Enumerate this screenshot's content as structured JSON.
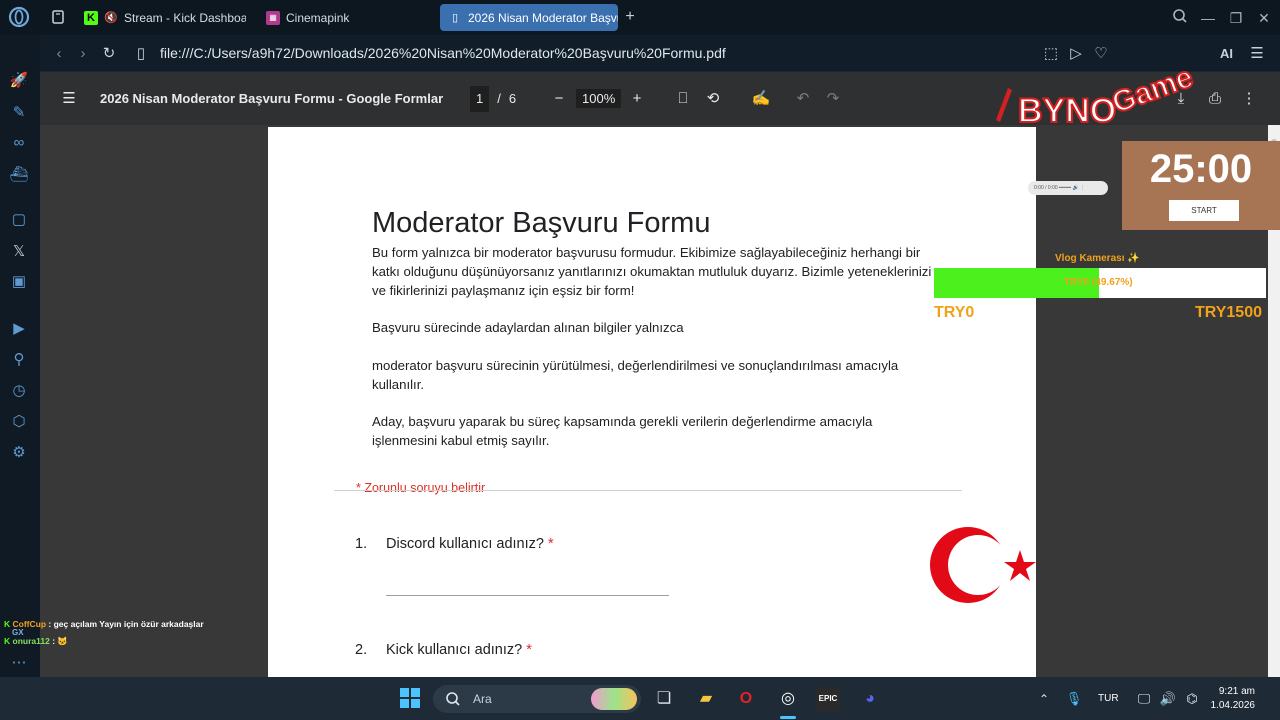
{
  "browser": {
    "tabs": [
      {
        "label": "Stream - Kick Dashboard",
        "icon": "kick-icon"
      },
      {
        "label": "Cinemapink",
        "icon": "cinema-icon"
      },
      {
        "label": "2026 Nisan Moderator Başvuru Formu",
        "icon": "pdf-icon",
        "active": true
      }
    ],
    "new_tab": "+",
    "url": "file:///C:/Users/a9h72/Downloads/2026%20Nisan%20Moderator%20Başvuru%20Formu.pdf",
    "ai_label": "AI"
  },
  "pdf_toolbar": {
    "title": "2026 Nisan Moderator Başvuru Formu - Google Formlar",
    "current_page": "1",
    "separator": "/",
    "total_pages": "6",
    "zoom": "100%"
  },
  "document": {
    "form_title": "Moderator Başvuru Formu",
    "paragraphs": [
      "Bu form yalnızca bir moderator başvurusu formudur. Ekibimize sağlayabileceğiniz herhangi bir katkı olduğunu düşünüyorsanız yanıtlarınızı okumaktan mutluluk duyarız. Bizimle yeteneklerinizi ve fikirlerinizi paylaşmanız için eşsiz bir form!",
      "Başvuru sürecinde adaylardan alınan bilgiler yalnızca",
      "moderator başvuru sürecinin yürütülmesi, değerlendirilmesi ve sonuçlandırılması amacıyla kullanılır.",
      "Aday, başvuru yaparak bu süreç kapsamında gerekli verilerin değerlendirme amacıyla işlenmesini kabul etmiş sayılır."
    ],
    "required_note": "* Zorunlu soruyu belirtir",
    "questions": [
      {
        "number": "1.",
        "text": "Discord kullanıcı adınız?",
        "required": "*"
      },
      {
        "number": "2.",
        "text": "Kick kullanıcı adınız?",
        "required": "*"
      }
    ]
  },
  "overlay": {
    "timer": "25:00",
    "timer_button": "START",
    "mini_player": "0:00 / 0:00",
    "goal_title": "Vlog Kamerası ✨",
    "goal_text": "TRY0 (49.67%)",
    "goal_fraction": 0.4967,
    "goal_min": "TRY0",
    "goal_max": "TRY1500",
    "logo_text_1": "BYNO",
    "logo_text_2": "Game"
  },
  "chat": [
    {
      "user": "CoffCup",
      "message": " : geç açılam Yayın için özür arkadaşlar"
    },
    {
      "user": "onura112",
      "message": " : 🐱"
    }
  ],
  "taskbar": {
    "search_placeholder": "Ara",
    "language": "TUR",
    "time": "9:21 am",
    "date": "1.04.2026"
  },
  "colors": {
    "accent_tab": "#3a6fb0",
    "sidebar_icons": "#5f9bd1",
    "goal_fill": "#4cf01c",
    "goal_text": "#f0a21a",
    "timer_bg": "#a77454",
    "required_red": "#d93025"
  }
}
